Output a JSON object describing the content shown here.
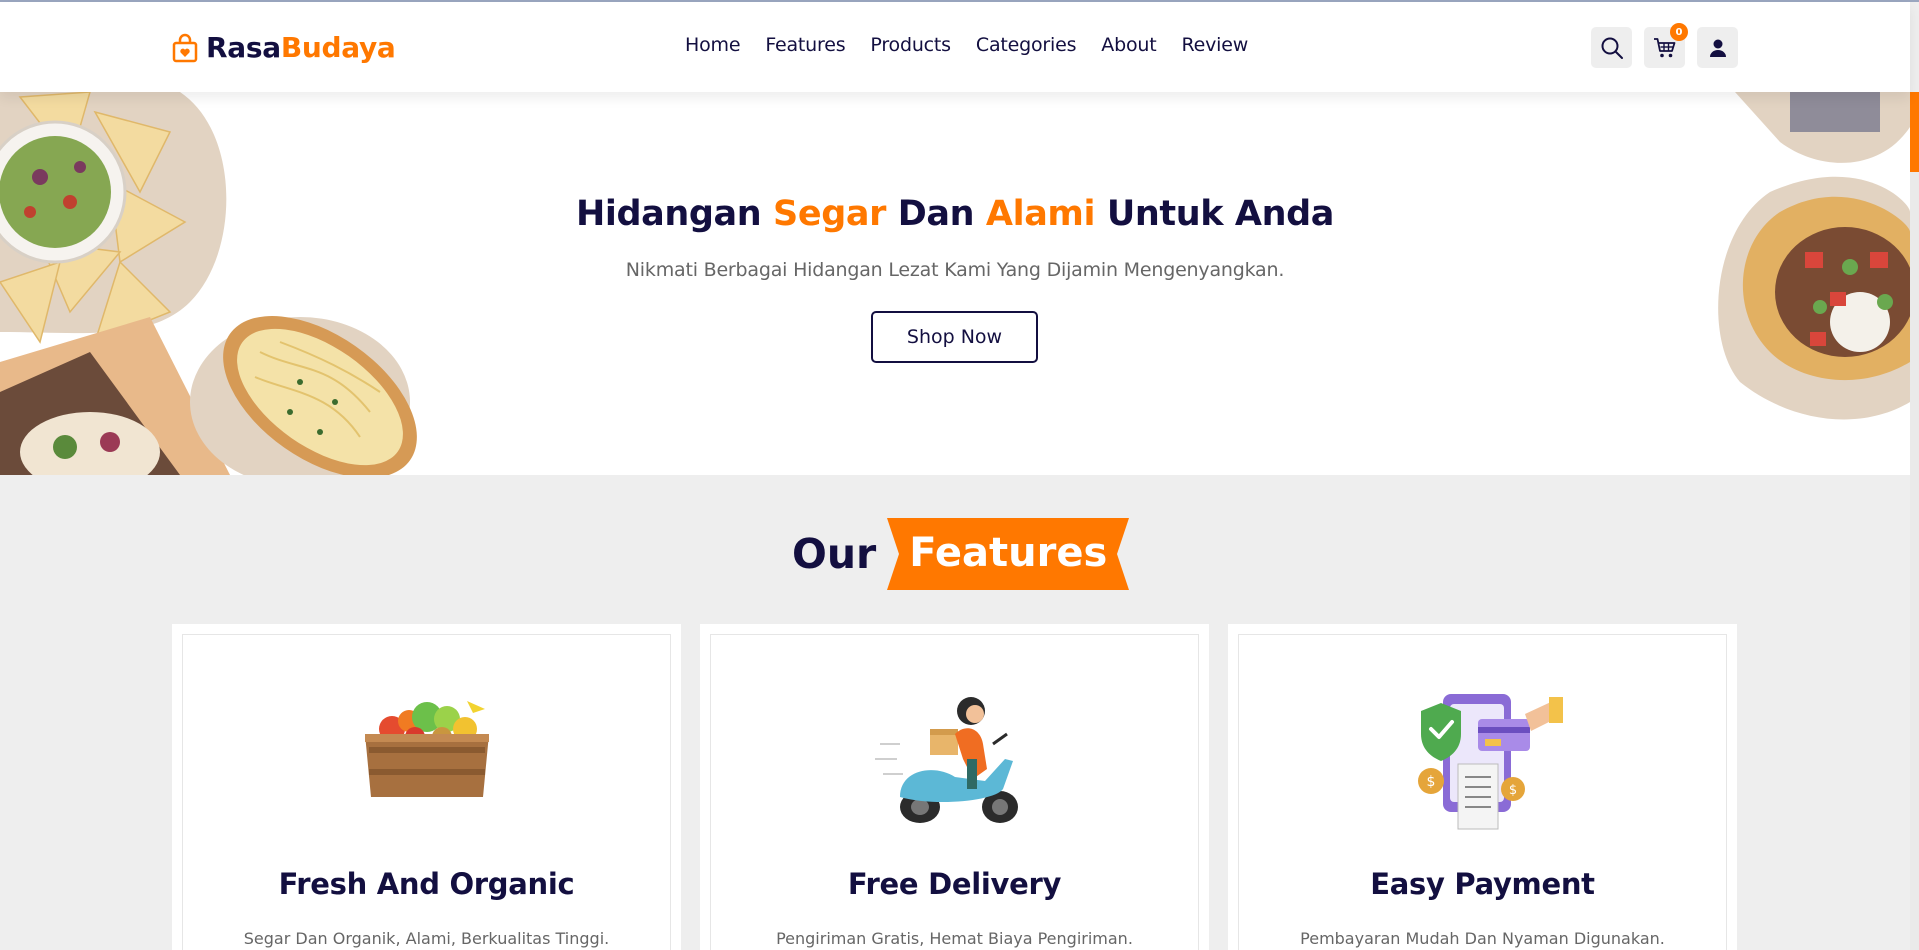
{
  "brand": {
    "part1": "Rasa",
    "part2": "Budaya"
  },
  "nav": [
    "Home",
    "Features",
    "Products",
    "Categories",
    "About",
    "Review"
  ],
  "header_icons": {
    "search": "search-icon",
    "cart": "cart-icon",
    "user": "user-icon",
    "cart_count": "0"
  },
  "hero": {
    "title_parts": [
      "Hidangan ",
      "Segar",
      " Dan ",
      "Alami",
      " Untuk Anda"
    ],
    "subtitle": "Nikmati Berbagai Hidangan Lezat Kami Yang Dijamin Mengenyangkan.",
    "button": "Shop Now"
  },
  "features": {
    "heading_left": "Our",
    "heading_right": "Features",
    "cards": [
      {
        "title": "Fresh And Organic",
        "description": "Segar Dan Organik, Alami, Berkualitas Tinggi.",
        "icon": "vegetable-crate-icon"
      },
      {
        "title": "Free Delivery",
        "description": "Pengiriman Gratis, Hemat Biaya Pengiriman.",
        "icon": "delivery-scooter-icon"
      },
      {
        "title": "Easy Payment",
        "description": "Pembayaran Mudah Dan Nyaman Digunakan.",
        "icon": "payment-phone-icon"
      }
    ]
  },
  "colors": {
    "accent": "#ff7800",
    "dark": "#130f40",
    "background": "#eeeeee"
  }
}
